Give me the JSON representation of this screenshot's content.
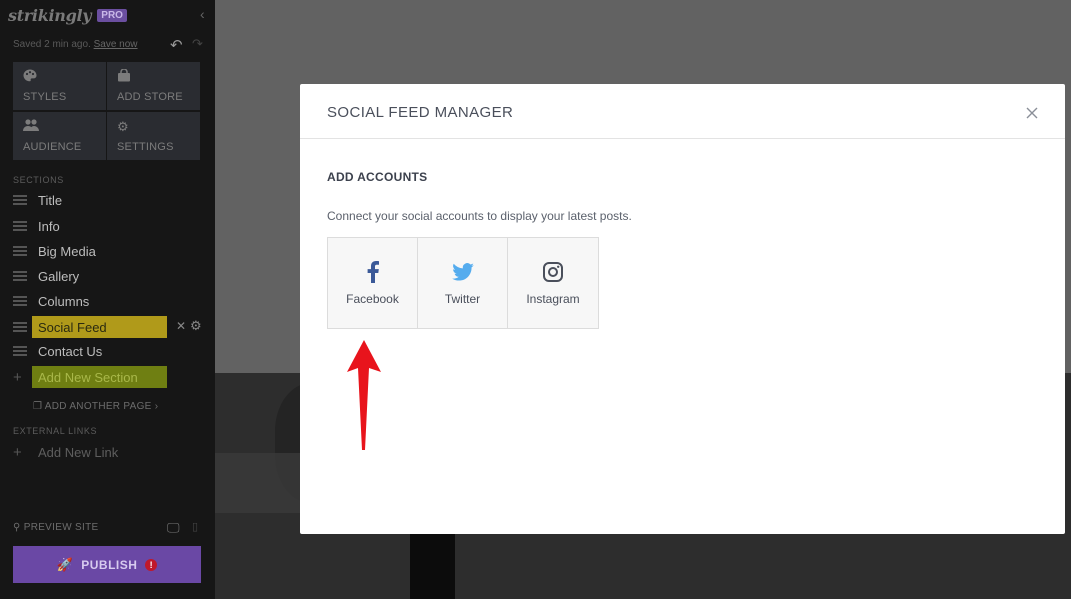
{
  "sidebar": {
    "logo": "strikingly",
    "badge": "PRO",
    "saved_text": "Saved 2 min ago.",
    "save_now": "Save now",
    "tools": [
      {
        "label": "STYLES",
        "icon": "palette-icon"
      },
      {
        "label": "ADD STORE",
        "icon": "store-icon"
      },
      {
        "label": "AUDIENCE",
        "icon": "people-icon"
      },
      {
        "label": "SETTINGS",
        "icon": "gear-icon"
      }
    ],
    "sections_heading": "SECTIONS",
    "sections": [
      "Title",
      "Info",
      "Big Media",
      "Gallery",
      "Columns",
      "Social Feed",
      "Contact Us"
    ],
    "active_section": "Social Feed",
    "add_section": "Add New Section",
    "add_page": "ADD ANOTHER PAGE",
    "external_heading": "EXTERNAL LINKS",
    "add_link": "Add New Link",
    "preview": "PREVIEW SITE",
    "publish": "PUBLISH"
  },
  "modal": {
    "title": "SOCIAL FEED MANAGER",
    "heading": "ADD ACCOUNTS",
    "description": "Connect your social accounts to display your latest posts.",
    "accounts": [
      {
        "label": "Facebook",
        "icon": "facebook-icon",
        "color": "#3b5998"
      },
      {
        "label": "Twitter",
        "icon": "twitter-icon",
        "color": "#55acee"
      },
      {
        "label": "Instagram",
        "icon": "instagram-icon",
        "color": "#4a4f5b"
      }
    ]
  },
  "annotation": {
    "color": "#e8141c"
  }
}
